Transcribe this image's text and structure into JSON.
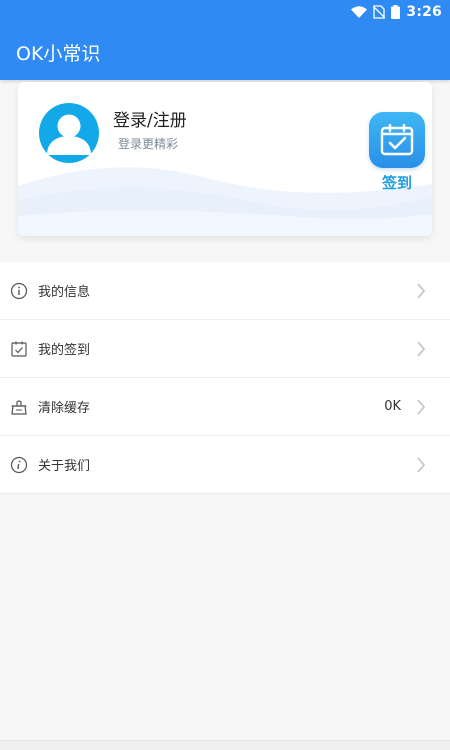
{
  "status_bar": {
    "time": "3:26",
    "icons": [
      "wifi-icon",
      "no-sim-icon",
      "battery-icon"
    ]
  },
  "app_bar": {
    "title": "OK小常识",
    "color": "#2f8bf3"
  },
  "user_card": {
    "login_title": "登录/注册",
    "login_subtitle": "登录更精彩",
    "avatar_icon": "user-avatar-icon",
    "signin_label": "签到",
    "signin_icon": "calendar-check-icon"
  },
  "menu": {
    "items": [
      {
        "label": "我的信息",
        "icon": "info-icon",
        "value": ""
      },
      {
        "label": "我的签到",
        "icon": "checkin-icon",
        "value": ""
      },
      {
        "label": "清除缓存",
        "icon": "broom-icon",
        "value": "0K"
      },
      {
        "label": "关于我们",
        "icon": "about-info-icon",
        "value": ""
      }
    ]
  }
}
